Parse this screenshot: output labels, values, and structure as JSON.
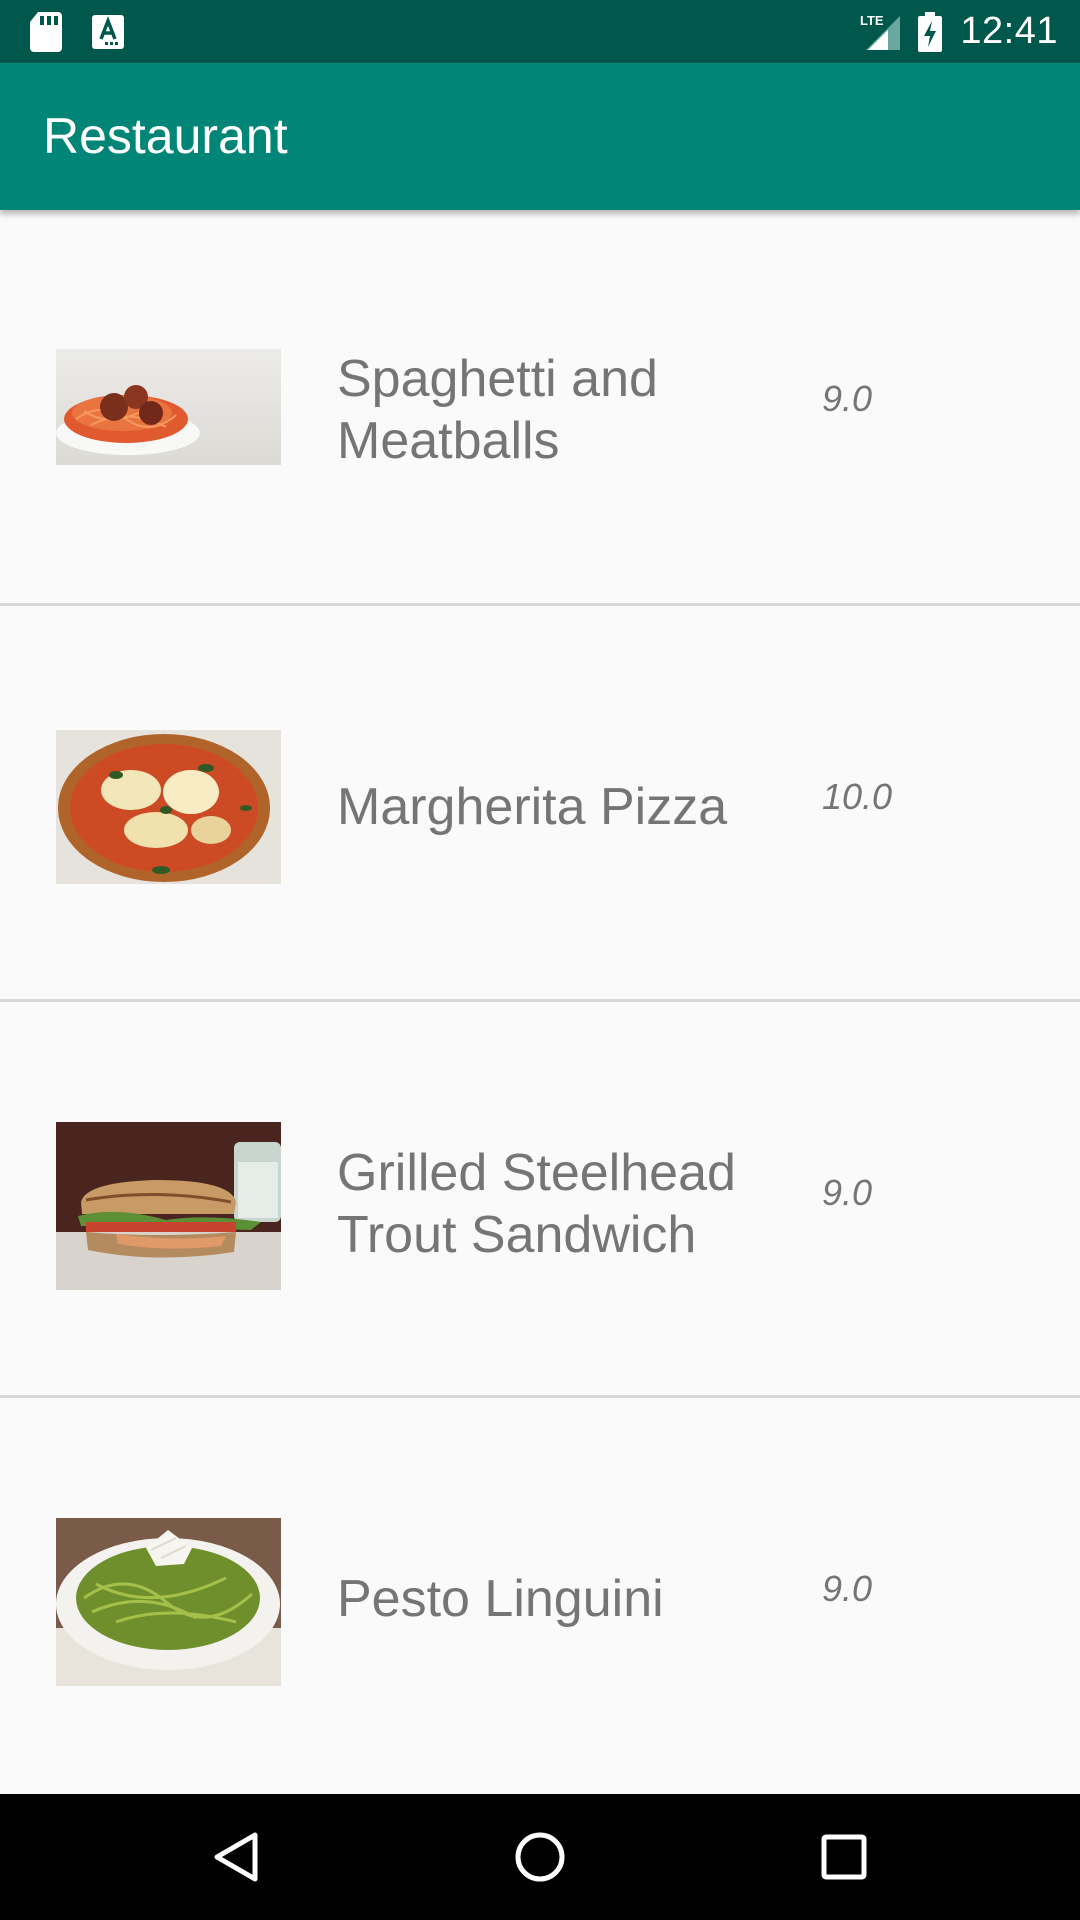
{
  "status_bar": {
    "time": "12:41",
    "network_label": "LTE",
    "left_icons": [
      "sd-card-icon",
      "autofill-app-icon"
    ],
    "right_icons": [
      "lte-signal-icon",
      "battery-charging-icon"
    ]
  },
  "app_bar": {
    "title": "Restaurant",
    "background": "#008577"
  },
  "menu_items": [
    {
      "name": "Spaghetti and Meatballs",
      "price": "9.0",
      "image": "spaghetti-meatballs-photo"
    },
    {
      "name": "Margherita Pizza",
      "price": "10.0",
      "image": "margherita-pizza-photo"
    },
    {
      "name": "Grilled Steelhead Trout Sandwich",
      "price": "9.0",
      "image": "trout-sandwich-photo"
    },
    {
      "name": "Pesto Linguini",
      "price": "9.0",
      "image": "pesto-linguini-photo"
    }
  ],
  "nav_bar": {
    "buttons": [
      "back-icon",
      "home-icon",
      "recents-icon"
    ]
  }
}
